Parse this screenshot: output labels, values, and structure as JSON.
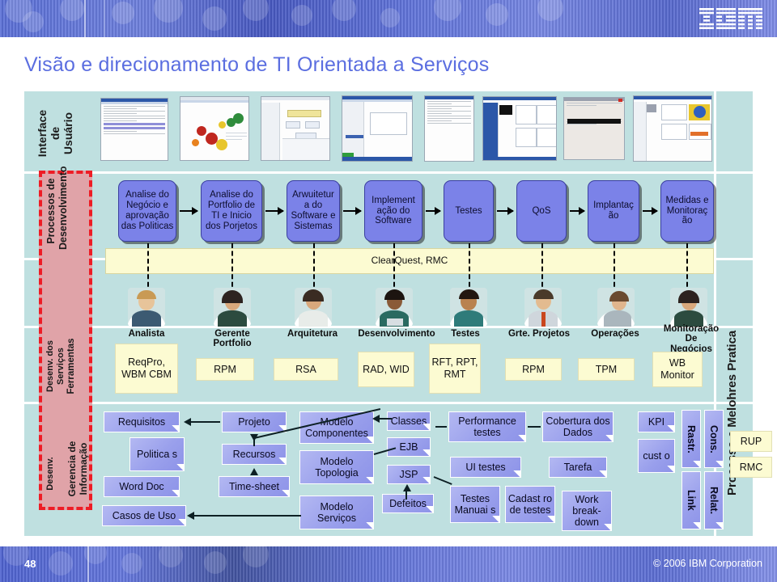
{
  "header": {
    "logo": "ibm-logo"
  },
  "page_title": "Visão e direcionamento de TI Orientada a Serviços",
  "footer": {
    "slide_number": "48",
    "copyright": "© 2006 IBM Corporation"
  },
  "colors": {
    "canvas": "#bfe0e0",
    "process_box": "#7b82e8",
    "tool_band": "#fcfbd2",
    "artifact_note": "#9aa0ec",
    "red_dashed": "#ee1c25",
    "title": "#5b6ee0",
    "header_band": "#5a6fd6"
  },
  "left_labels": [
    {
      "text": "Interface\nde\nUsuário",
      "name": "interface-usuario"
    },
    {
      "text": "Processos de\nDesenvolvimento",
      "name": "processos-desenvolvimento"
    },
    {
      "text": "Desenv. dos\nServiços",
      "name": "desenv-servicos"
    },
    {
      "text": "Ferramentas",
      "name": "ferramentas"
    },
    {
      "text": "Desenv.",
      "name": "desenv"
    },
    {
      "text": "Gerencia de\nInformação",
      "name": "gerencia-informacao"
    }
  ],
  "right_label": "Processo e Melohres Pratica",
  "process_boxes": [
    {
      "label": "Analise do Negócio e aprovação das Politicas"
    },
    {
      "label": "Analise do Portfolio de TI e Inicio dos Porjetos"
    },
    {
      "label": "Arwuitetur a do Software e Sistemas"
    },
    {
      "label": "Implement ação do Software"
    },
    {
      "label": "Testes"
    },
    {
      "label": "QoS"
    },
    {
      "label": "Implantaç ão"
    },
    {
      "label": "Medidas e Monitoraç ão"
    }
  ],
  "tool_band_label": "ClearQuest, RMC",
  "roles": [
    {
      "label": "Analista"
    },
    {
      "label": "Gerente Portfolio"
    },
    {
      "label": "Arquitetura"
    },
    {
      "label": "Desenvolvimento"
    },
    {
      "label": "Testes"
    },
    {
      "label": "Grte. Projetos"
    },
    {
      "label": "Operações"
    },
    {
      "label": "Monitoração De Negócios"
    }
  ],
  "role_tools": [
    {
      "label": "ReqPro, WBM CBM"
    },
    {
      "label": "RPM"
    },
    {
      "label": "RSA"
    },
    {
      "label": "RAD, WID"
    },
    {
      "label": "RFT, RPT, RMT"
    },
    {
      "label": "RPM"
    },
    {
      "label": "TPM"
    },
    {
      "label": "WB Monitor"
    }
  ],
  "artifacts": [
    {
      "label": "Requisitos"
    },
    {
      "label": "Politica s"
    },
    {
      "label": "Word Doc"
    },
    {
      "label": "Casos de Uso"
    },
    {
      "label": "Projeto"
    },
    {
      "label": "Recursos"
    },
    {
      "label": "Time-sheet"
    },
    {
      "label": "Modelo Componentes"
    },
    {
      "label": "Modelo Topologia"
    },
    {
      "label": "Modelo Serviços"
    },
    {
      "label": "Classes"
    },
    {
      "label": "EJB"
    },
    {
      "label": "JSP"
    },
    {
      "label": "Defeitos"
    },
    {
      "label": "Performance testes"
    },
    {
      "label": "UI testes"
    },
    {
      "label": "Testes Manuai s"
    },
    {
      "label": "Cadast ro de testes"
    },
    {
      "label": "Cobertura dos Dados"
    },
    {
      "label": "Tarefa"
    },
    {
      "label": "Work break- down"
    },
    {
      "label": "KPI"
    },
    {
      "label": "cust o"
    },
    {
      "label": "Rastr."
    },
    {
      "label": "Cons."
    },
    {
      "label": "Link"
    },
    {
      "label": "Relat."
    }
  ],
  "process_assets": [
    {
      "label": "RUP"
    },
    {
      "label": "RMC"
    }
  ]
}
